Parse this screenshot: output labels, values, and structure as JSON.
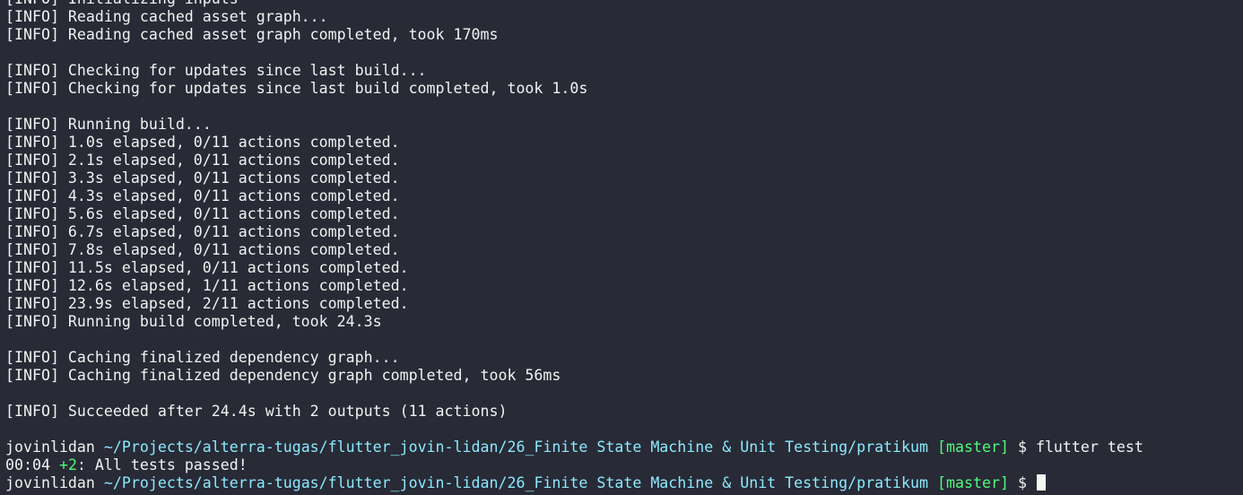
{
  "log_lines": [
    "[INFO] Initializing inputs",
    "[INFO] Reading cached asset graph...",
    "[INFO] Reading cached asset graph completed, took 170ms",
    "",
    "[INFO] Checking for updates since last build...",
    "[INFO] Checking for updates since last build completed, took 1.0s",
    "",
    "[INFO] Running build...",
    "[INFO] 1.0s elapsed, 0/11 actions completed.",
    "[INFO] 2.1s elapsed, 0/11 actions completed.",
    "[INFO] 3.3s elapsed, 0/11 actions completed.",
    "[INFO] 4.3s elapsed, 0/11 actions completed.",
    "[INFO] 5.6s elapsed, 0/11 actions completed.",
    "[INFO] 6.7s elapsed, 0/11 actions completed.",
    "[INFO] 7.8s elapsed, 0/11 actions completed.",
    "[INFO] 11.5s elapsed, 0/11 actions completed.",
    "[INFO] 12.6s elapsed, 1/11 actions completed.",
    "[INFO] 23.9s elapsed, 2/11 actions completed.",
    "[INFO] Running build completed, took 24.3s",
    "",
    "[INFO] Caching finalized dependency graph...",
    "[INFO] Caching finalized dependency graph completed, took 56ms",
    "",
    "[INFO] Succeeded after 24.4s with 2 outputs (11 actions)",
    ""
  ],
  "prompt1": {
    "user": "jovinlidan",
    "path": "~/Projects/alterra-tugas/flutter_jovin-lidan/26_Finite State Machine & Unit Testing/pratikum",
    "branch": "[master]",
    "symbol": "$",
    "command": "flutter test"
  },
  "test_result": {
    "time": "00:04",
    "count": "+2",
    "message": ": All tests passed!"
  },
  "prompt2": {
    "user": "jovinlidan",
    "path": "~/Projects/alterra-tugas/flutter_jovin-lidan/26_Finite State Machine & Unit Testing/pratikum",
    "branch": "[master]",
    "symbol": "$"
  },
  "colors": {
    "background": "#282a36",
    "text": "#f2f2f2",
    "path": "#8be9fd",
    "branch": "#50fa7b",
    "passed": "#50fa7b"
  }
}
